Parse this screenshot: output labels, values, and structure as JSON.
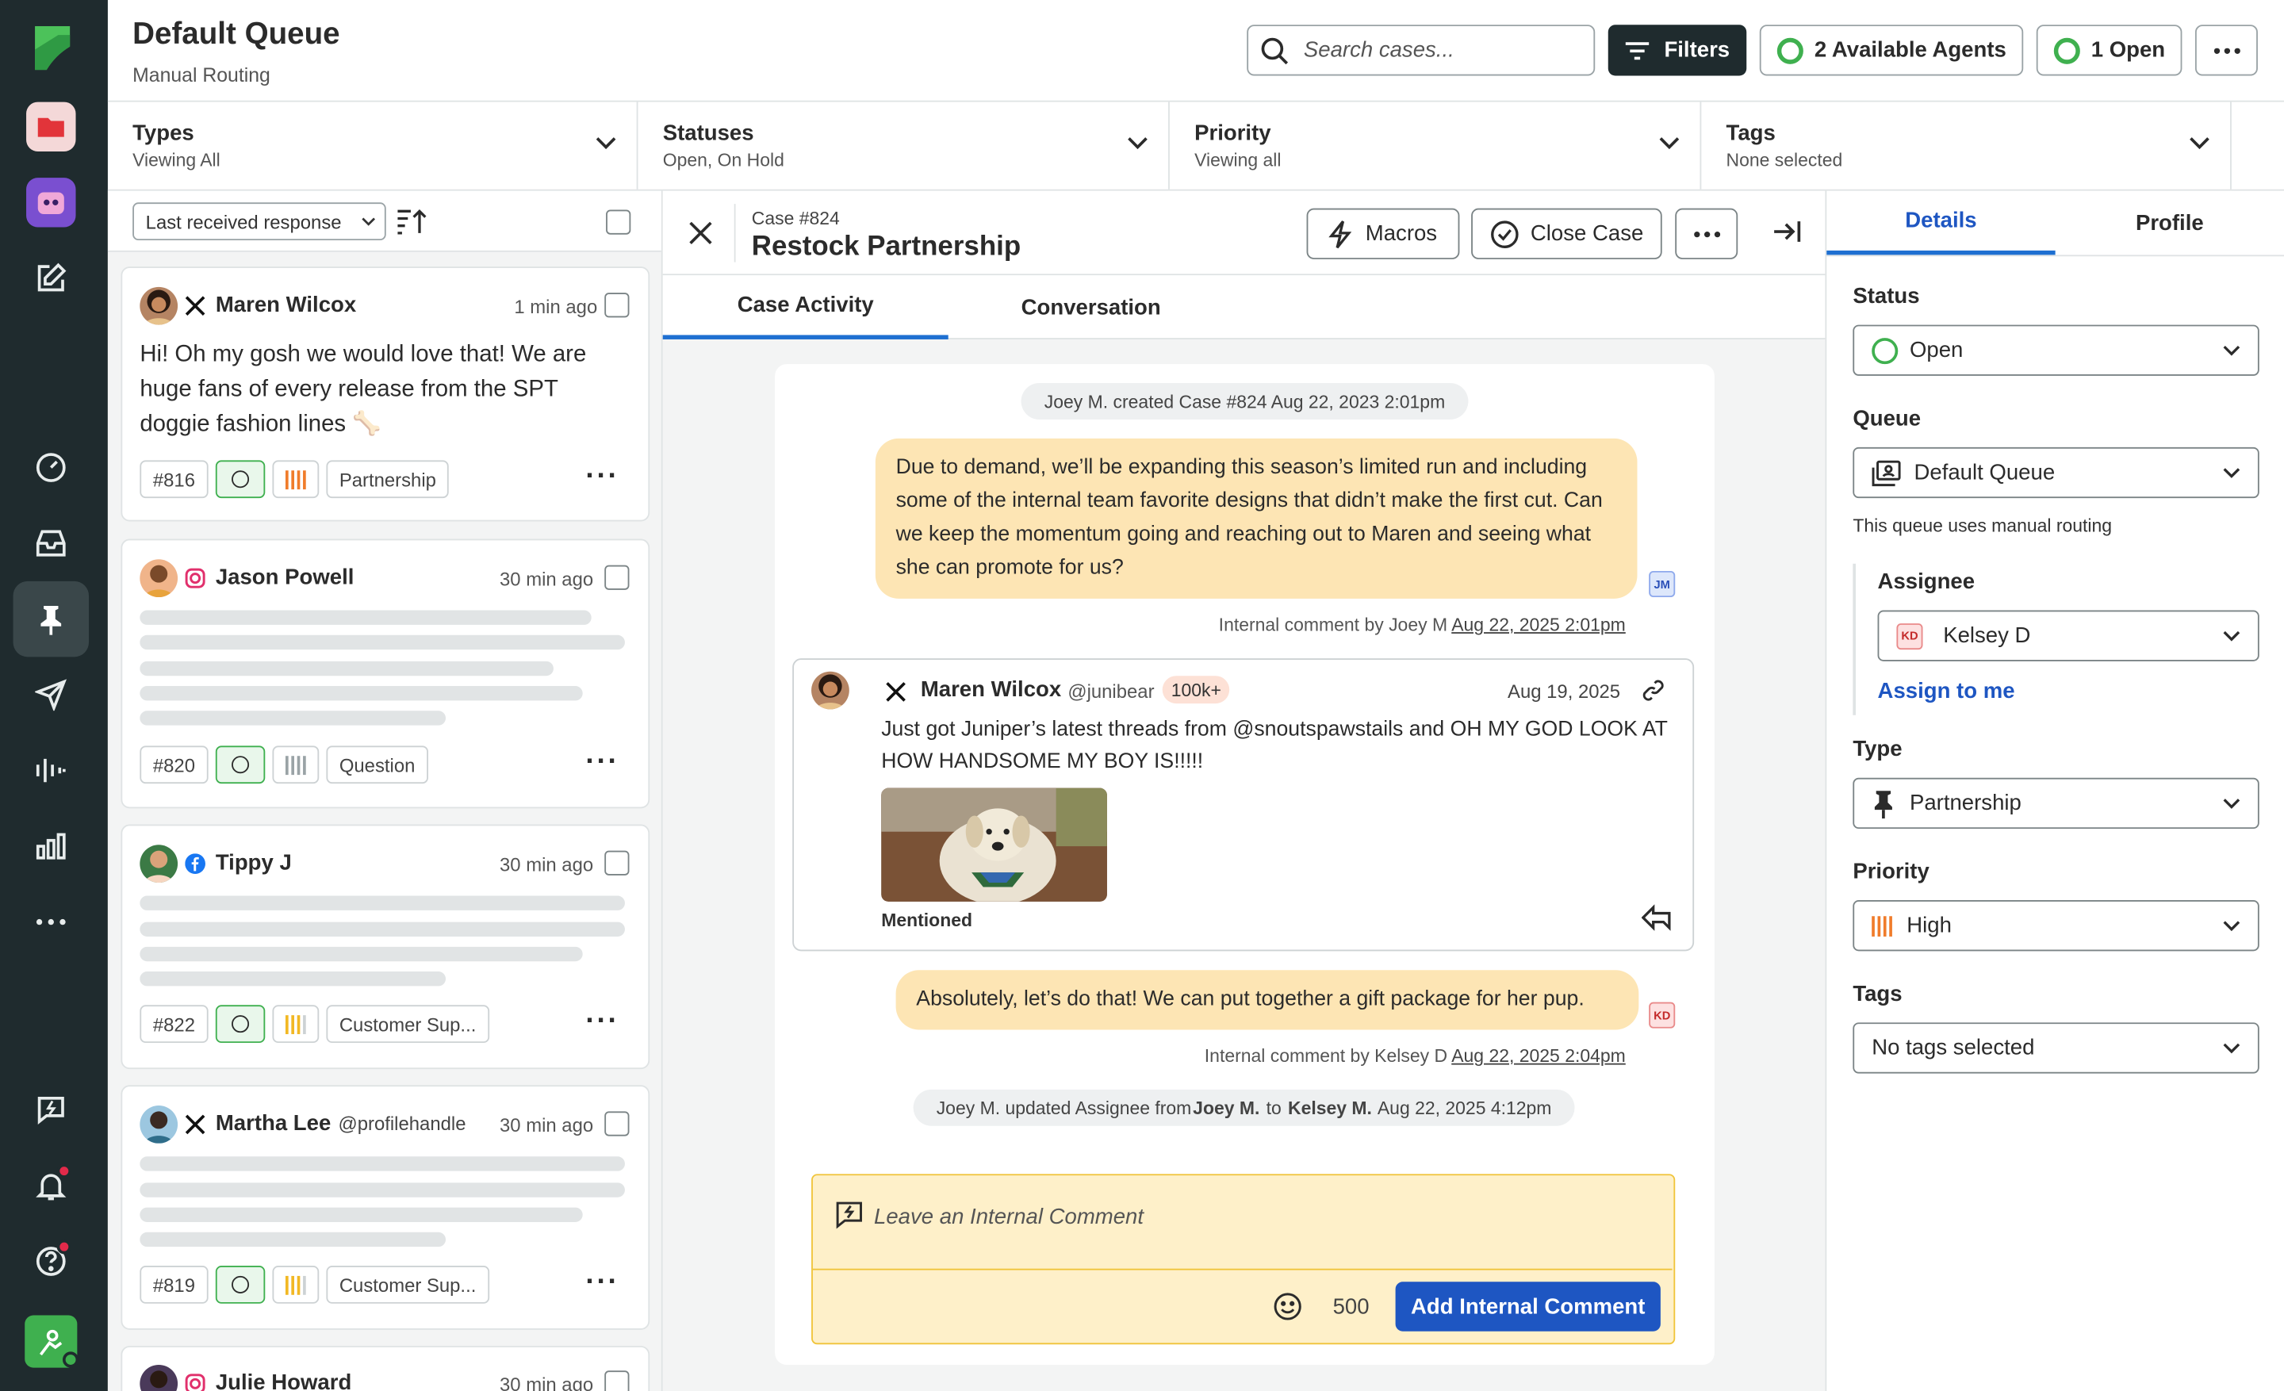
{
  "header": {
    "title": "Default Queue",
    "subtitle": "Manual Routing",
    "search_placeholder": "Search cases...",
    "filters_label": "Filters",
    "agents_label": "2 Available Agents",
    "open_label": "1 Open"
  },
  "filters": [
    {
      "title": "Types",
      "value": "Viewing All"
    },
    {
      "title": "Statuses",
      "value": "Open, On Hold"
    },
    {
      "title": "Priority",
      "value": "Viewing all"
    },
    {
      "title": "Tags",
      "value": "None selected"
    }
  ],
  "case_list": {
    "sort_label": "Last received response",
    "cards": [
      {
        "name": "Maren Wilcox",
        "network": "x",
        "time": "1 min ago",
        "text": "Hi! Oh my gosh we would love that! We are huge fans of every release from the SPT doggie fashion lines 🦴",
        "id": "#816",
        "tag": "Partnership",
        "priority": "high"
      },
      {
        "name": "Jason Powell",
        "network": "instagram",
        "time": "30 min ago",
        "id": "#820",
        "tag": "Question",
        "priority": "low"
      },
      {
        "name": "Tippy J",
        "network": "facebook",
        "time": "30 min ago",
        "id": "#822",
        "tag": "Customer Sup...",
        "priority": "medium"
      },
      {
        "name": "Martha Lee",
        "handle": "@profilehandle",
        "network": "x",
        "time": "30 min ago",
        "id": "#819",
        "tag": "Customer Sup...",
        "priority": "medium"
      },
      {
        "name": "Julie Howard",
        "network": "instagram",
        "time": "30 min ago"
      }
    ]
  },
  "case": {
    "number": "Case #824",
    "title": "Restock Partnership",
    "macros_label": "Macros",
    "close_label": "Close Case",
    "tabs": [
      "Case Activity",
      "Conversation"
    ]
  },
  "activity": {
    "created": "Joey M. created Case #824 Aug 22, 2023 2:01pm",
    "comment1": "Due to demand, we’ll be expanding this season’s limited run and including some of the internal team favorite designs that didn’t make the first cut. Can we keep the momentum going and reaching out to Maren and seeing what she can promote for us?",
    "comment1_initials": "JM",
    "comment1_meta": "Internal comment by Joey M",
    "comment1_date": "Aug 22, 2025 2:01pm",
    "post": {
      "name": "Maren Wilcox",
      "handle": "@junibear",
      "followers": "100k+",
      "date": "Aug 19, 2025",
      "text": "Just got Juniper’s latest threads from @snoutspawstails and OH MY GOD LOOK AT HOW HANDSOME MY BOY IS!!!!!",
      "label": "Mentioned"
    },
    "comment2": "Absolutely, let’s do that! We can put together a gift package for her pup.",
    "comment2_initials": "KD",
    "comment2_meta": "Internal comment by Kelsey D",
    "comment2_date": "Aug 22, 2025 2:04pm",
    "update_prefix": "Joey M. updated Assignee from ",
    "update_from": "Joey M.",
    "update_to_word": " to ",
    "update_to": "Kelsey M.",
    "update_date": " Aug 22, 2025 4:12pm"
  },
  "composer": {
    "placeholder": "Leave an Internal Comment",
    "char_count": "500",
    "submit_label": "Add Internal Comment"
  },
  "details": {
    "tabs": [
      "Details",
      "Profile"
    ],
    "status_label": "Status",
    "status_value": "Open",
    "queue_label": "Queue",
    "queue_value": "Default Queue",
    "queue_note": "This queue uses manual routing",
    "assignee_label": "Assignee",
    "assignee_value": "Kelsey D",
    "assignee_initials": "KD",
    "assign_me": "Assign to me",
    "type_label": "Type",
    "type_value": "Partnership",
    "priority_label": "Priority",
    "priority_value": "High",
    "tags_label": "Tags",
    "tags_value": "No tags selected"
  },
  "colors": {
    "accent": "#1e6fd1",
    "nav_bg": "#1f2b2e",
    "comment_bg": "#fde5b4",
    "available": "#3fb04f",
    "priority_high": "#f07c2b"
  }
}
